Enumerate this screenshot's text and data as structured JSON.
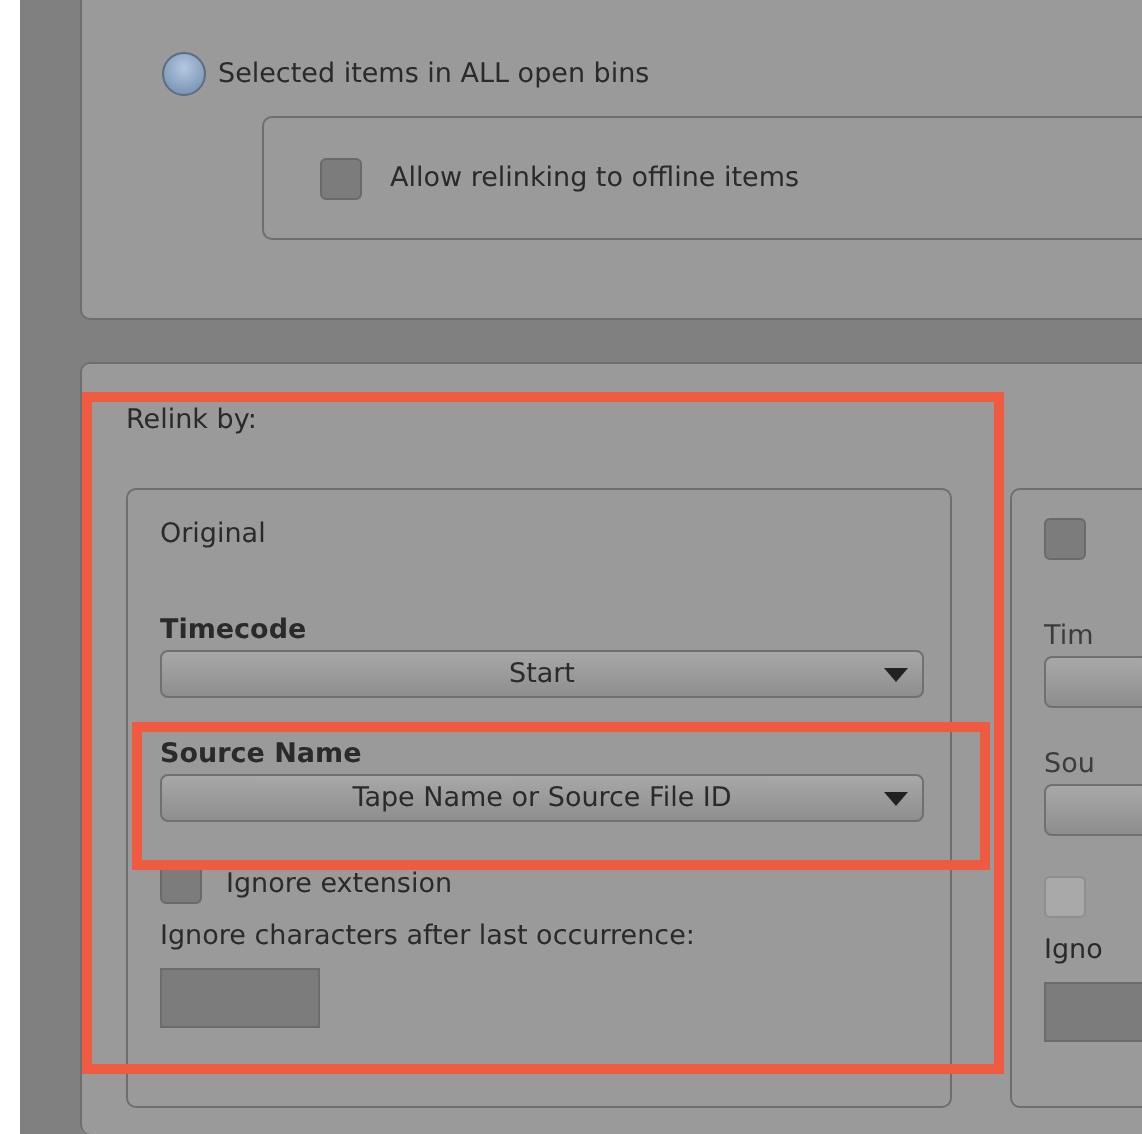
{
  "scope": {
    "option": {
      "label": "Selected items in ALL open bins",
      "selected": true
    },
    "checkbox": {
      "label": "Allow relinking to offline items",
      "checked": false
    }
  },
  "relink_by": {
    "label": "Relink by:",
    "original": {
      "title": "Original",
      "timecode_label": "Timecode",
      "timecode_value": "Start",
      "source_label": "Source Name",
      "source_value": "Tape Name or Source File ID",
      "ignore_extension": {
        "label": "Ignore extension",
        "checked": false
      },
      "ignore_chars_label": "Ignore characters after last occurrence:"
    },
    "second": {
      "checked": false,
      "timecode_label": "Tim",
      "source_label": "Sou",
      "ignore_extension_checked": false,
      "ignore_chars_label": "Igno"
    }
  }
}
